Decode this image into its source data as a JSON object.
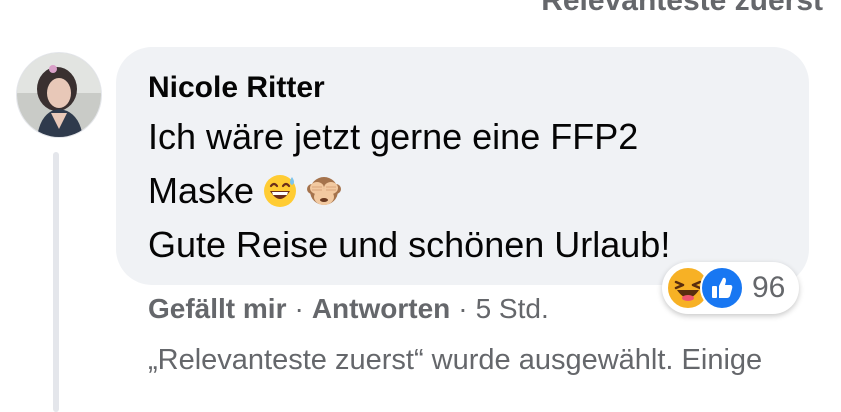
{
  "sort": {
    "label": "Relevanteste zuerst"
  },
  "comment": {
    "author": "Nicole Ritter",
    "text_line1": "Ich wäre jetzt gerne eine FFP2",
    "text_line2": "Maske",
    "text_line2_emojis": [
      "grinning-sweat-emoji",
      "see-no-evil-monkey-emoji"
    ],
    "text_line3": "Gute Reise und schönen Urlaub!",
    "reactions": {
      "icons": [
        "laughing-reaction-icon",
        "like-reaction-icon"
      ],
      "count": "96"
    },
    "actions": {
      "like_label": "Gefällt mir",
      "separator": "·",
      "reply_label": "Antworten",
      "timestamp": "5 Std."
    }
  },
  "notice": {
    "text": "„Relevanteste zuerst“ wurde ausgewählt. Einige"
  },
  "colors": {
    "bubble_bg": "#f0f2f5",
    "secondary_text": "#65676b",
    "like_blue": "#1877f2",
    "haha_yellow": "#f7b125"
  }
}
